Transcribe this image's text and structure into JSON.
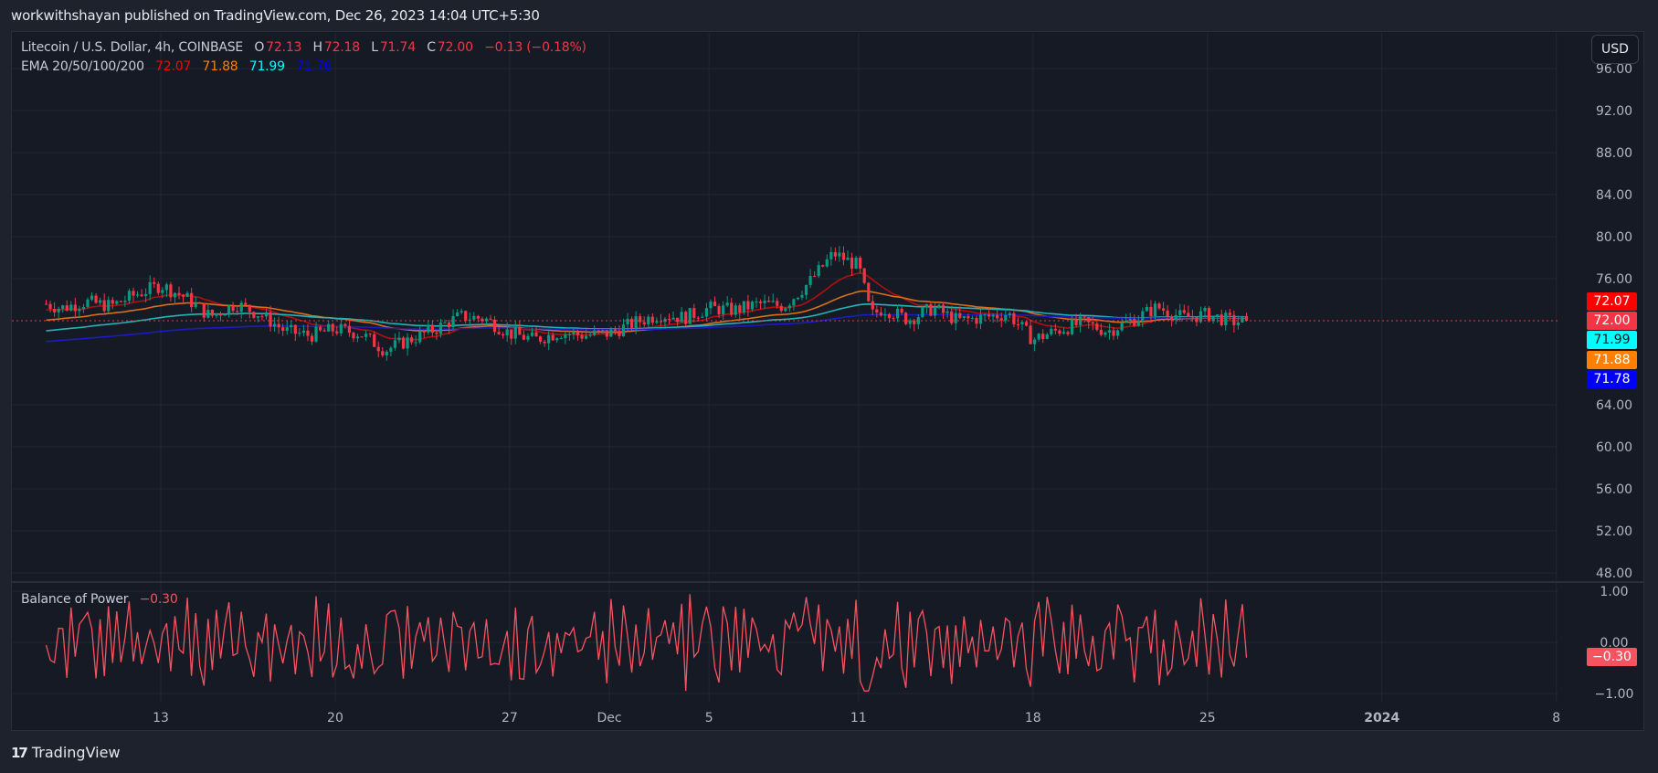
{
  "header": {
    "published_line": "workwithshayan published on TradingView.com, Dec 26, 2023 14:04 UTC+5:30"
  },
  "legend": {
    "symbol": "Litecoin / U.S. Dollar, 4h, COINBASE",
    "open_label": "O",
    "open": "72.13",
    "high_label": "H",
    "high": "72.18",
    "low_label": "L",
    "low": "71.74",
    "close_label": "C",
    "close": "72.00",
    "change": "−0.13 (−0.18%)",
    "ema_title": "EMA 20/50/100/200",
    "ema_values": [
      "72.07",
      "71.88",
      "71.99",
      "71.78"
    ]
  },
  "currency_button": "USD",
  "price_labels": [
    {
      "value": "72.07",
      "bg": "#ff0000",
      "fg": "#ffffff"
    },
    {
      "value": "72.00",
      "bg": "#f23645",
      "fg": "#ffffff"
    },
    {
      "value": "71.99",
      "bg": "#00ffff",
      "fg": "#131722"
    },
    {
      "value": "71.88",
      "bg": "#ff8000",
      "fg": "#ffffff"
    },
    {
      "value": "71.78",
      "bg": "#0000ff",
      "fg": "#ffffff"
    }
  ],
  "bop": {
    "title": "Balance of Power",
    "value": "−0.30",
    "label_bg": "#f7525f"
  },
  "footer": {
    "brand": "TradingView",
    "logo_glyph": "17"
  },
  "colors": {
    "up": "#089981",
    "down": "#f23645",
    "ema20": "#b20e12",
    "ema50": "#d97019",
    "ema100": "#21b5b5",
    "ema200": "#1b1bc8",
    "bop_line": "#f7525f",
    "last_price_line": "#f23645"
  },
  "chart_data": [
    {
      "type": "candlestick",
      "title": "Litecoin / U.S. Dollar, 4h, COINBASE",
      "ylabel": "USD",
      "ylim": [
        48,
        96
      ],
      "y_ticks": [
        "96.00",
        "92.00",
        "88.00",
        "84.00",
        "80.00",
        "76.00",
        "64.00",
        "60.00",
        "56.00",
        "52.00",
        "48.00"
      ],
      "x_ticks": [
        "13",
        "20",
        "27",
        "Dec",
        "5",
        "11",
        "18",
        "25",
        "2024",
        "8"
      ],
      "x_tick_days": [
        13,
        20,
        27,
        31,
        35,
        41,
        48,
        55,
        62,
        69
      ],
      "start_day": 8.4,
      "end_day": 56.7,
      "last_price": 72.0,
      "price_path_keypoints": [
        [
          8.4,
          73.6
        ],
        [
          9,
          73.2
        ],
        [
          10,
          73.8
        ],
        [
          11,
          73.4
        ],
        [
          12,
          74.5
        ],
        [
          13,
          75.4
        ],
        [
          14,
          74.2
        ],
        [
          15,
          72.4
        ],
        [
          16,
          73.6
        ],
        [
          17,
          72.6
        ],
        [
          18,
          71.0
        ],
        [
          19,
          70.6
        ],
        [
          20,
          71.2
        ],
        [
          21,
          70.8
        ],
        [
          22,
          69.2
        ],
        [
          23,
          70.2
        ],
        [
          24,
          71.2
        ],
        [
          25,
          72.4
        ],
        [
          26,
          72.2
        ],
        [
          27,
          70.8
        ],
        [
          28,
          70.2
        ],
        [
          29,
          70.9
        ],
        [
          30,
          70.6
        ],
        [
          31,
          70.8
        ],
        [
          32,
          71.8
        ],
        [
          33,
          72.6
        ],
        [
          34,
          72.3
        ],
        [
          35,
          73.2
        ],
        [
          36,
          73.0
        ],
        [
          37,
          73.6
        ],
        [
          38,
          73.4
        ],
        [
          39,
          75.6
        ],
        [
          40,
          78.4
        ],
        [
          41,
          77.2
        ],
        [
          41.5,
          72.5
        ],
        [
          42,
          73.2
        ],
        [
          43,
          72.1
        ],
        [
          44,
          73.2
        ],
        [
          45,
          72.0
        ],
        [
          46,
          72.3
        ],
        [
          47,
          72.7
        ],
        [
          48,
          70.2
        ],
        [
          49,
          71.1
        ],
        [
          50,
          71.8
        ],
        [
          51,
          71.0
        ],
        [
          52,
          72.1
        ],
        [
          53,
          73.3
        ],
        [
          54,
          72.3
        ],
        [
          55,
          72.6
        ],
        [
          56,
          71.9
        ],
        [
          56.7,
          72.0
        ]
      ],
      "series": [
        {
          "name": "EMA 20",
          "last": 72.07
        },
        {
          "name": "EMA 50",
          "last": 71.88
        },
        {
          "name": "EMA 100",
          "last": 71.99
        },
        {
          "name": "EMA 200",
          "last": 71.78
        }
      ]
    },
    {
      "type": "line",
      "title": "Balance of Power",
      "ylim": [
        -1.0,
        1.0
      ],
      "y_ticks": [
        "1.00",
        "0.00",
        "−1.00"
      ],
      "last_value": -0.3
    }
  ]
}
